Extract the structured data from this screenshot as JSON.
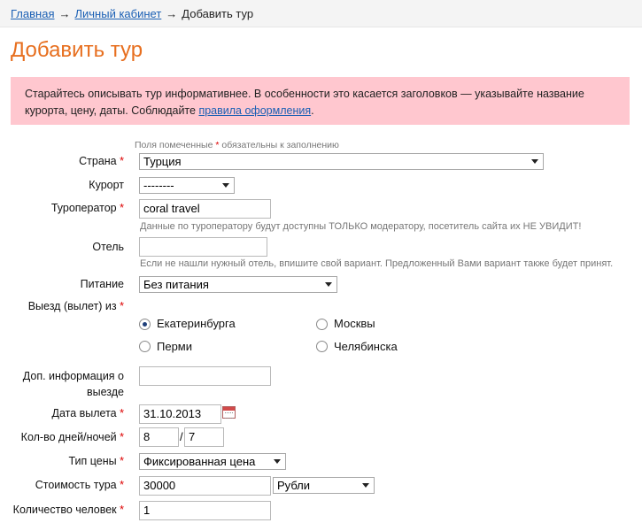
{
  "breadcrumbs": {
    "home": "Главная",
    "cabinet": "Личный кабинет",
    "current": "Добавить тур",
    "separator": "→"
  },
  "page_title": "Добавить тур",
  "notice": {
    "text": "Старайтесь описывать тур информативнее. В особенности это касается заголовков — указывайте название курорта, цену, даты. Соблюдайте",
    "link": "правила оформления",
    "end": "."
  },
  "required_note": {
    "before": "Поля помеченные",
    "star": "*",
    "after": "обязательны к заполнению"
  },
  "form": {
    "country": {
      "label": "Страна",
      "value": "Турция"
    },
    "resort": {
      "label": "Курорт",
      "value": "--------"
    },
    "operator": {
      "label": "Туроператор",
      "value": "coral travel",
      "hint": "Данные по туроператору будут доступны ТОЛЬКО модератору, посетитель сайта их НЕ УВИДИТ!"
    },
    "hotel": {
      "label": "Отель",
      "value": "",
      "hint": "Если не нашли нужный отель, впишите свой вариант. Предложенный Вами вариант также будет принят."
    },
    "meals": {
      "label": "Питание",
      "value": "Без питания"
    },
    "departure": {
      "label": "Выезд (вылет) из",
      "options": [
        "Екатеринбурга",
        "Москвы",
        "Перми",
        "Челябинска"
      ],
      "selected": "Екатеринбурга"
    },
    "extra_info": {
      "label_line1": "Доп. информация о",
      "label_line2": "выезде",
      "value": ""
    },
    "date": {
      "label": "Дата вылета",
      "value": "31.10.2013"
    },
    "duration": {
      "label": "Кол-во дней/ночей",
      "days": "8",
      "separator": "/",
      "nights": "7"
    },
    "price_type": {
      "label": "Тип цены",
      "value": "Фиксированная цена"
    },
    "cost": {
      "label": "Стоимость тура",
      "value": "30000",
      "currency": "Рубли"
    },
    "people": {
      "label": "Количество человек",
      "value": "1"
    },
    "required_star": "*"
  },
  "colors": {
    "title": "#e76f1f",
    "notice_bg": "#ffc7cf",
    "link": "#1a5fb4",
    "required": "#dd0000"
  }
}
